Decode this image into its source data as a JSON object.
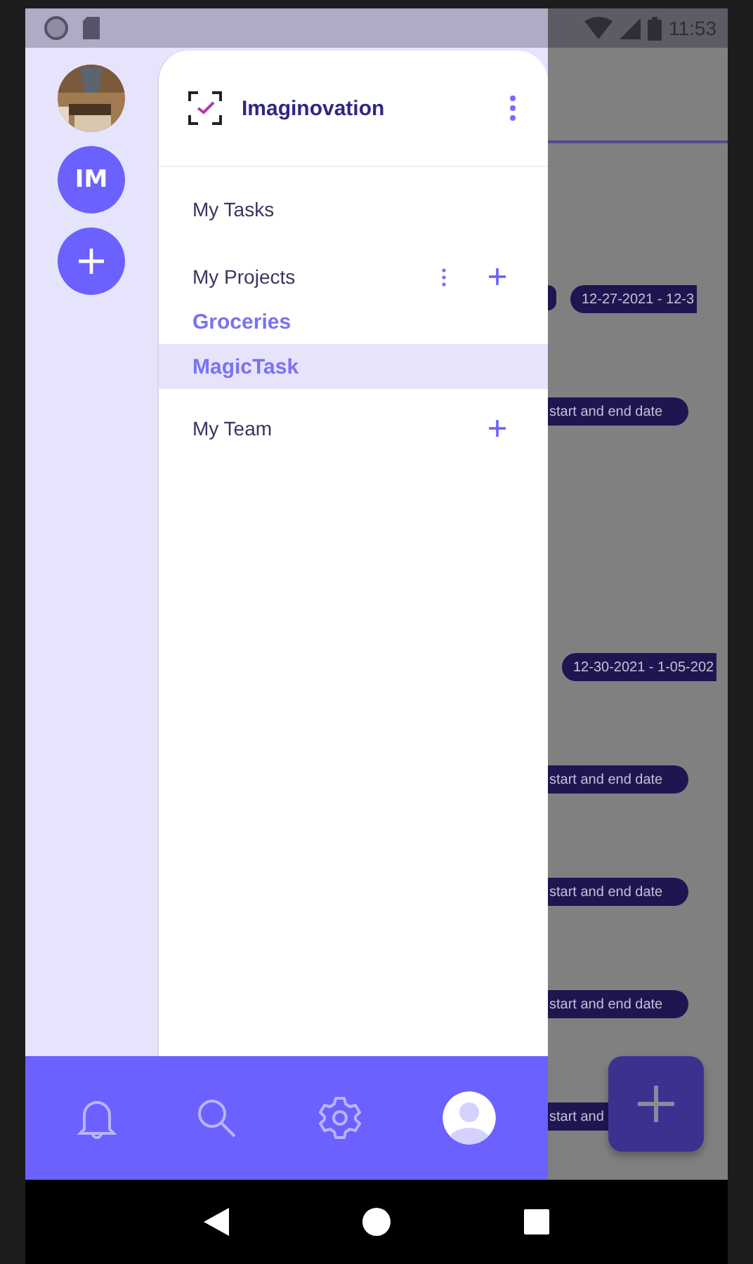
{
  "status_bar": {
    "time": "11:53"
  },
  "rail": {
    "accounts": [
      {
        "kind": "picture"
      },
      {
        "kind": "initials",
        "label": "IM"
      }
    ]
  },
  "drawer": {
    "title": "Imaginovation",
    "sections": [
      {
        "label": "My Tasks",
        "has_menu": false,
        "has_add": false
      },
      {
        "label": "My Projects",
        "has_menu": true,
        "has_add": true,
        "projects": [
          {
            "label": "Groceries",
            "selected": false
          },
          {
            "label": "MagicTask",
            "selected": true
          }
        ]
      },
      {
        "label": "My Team",
        "has_menu": false,
        "has_add": true
      }
    ]
  },
  "background": {
    "pills": [
      {
        "kind": "date",
        "label": "12-27-2021 - 12-3"
      },
      {
        "kind": "hint",
        "label": "start and end date"
      },
      {
        "kind": "date",
        "label": "12-30-2021 - 1-05-202"
      },
      {
        "kind": "hint",
        "label": "start and end date"
      },
      {
        "kind": "hint",
        "label": "start and end date"
      },
      {
        "kind": "hint",
        "label": "start and end date"
      },
      {
        "kind": "hint",
        "label": "start and"
      }
    ]
  }
}
